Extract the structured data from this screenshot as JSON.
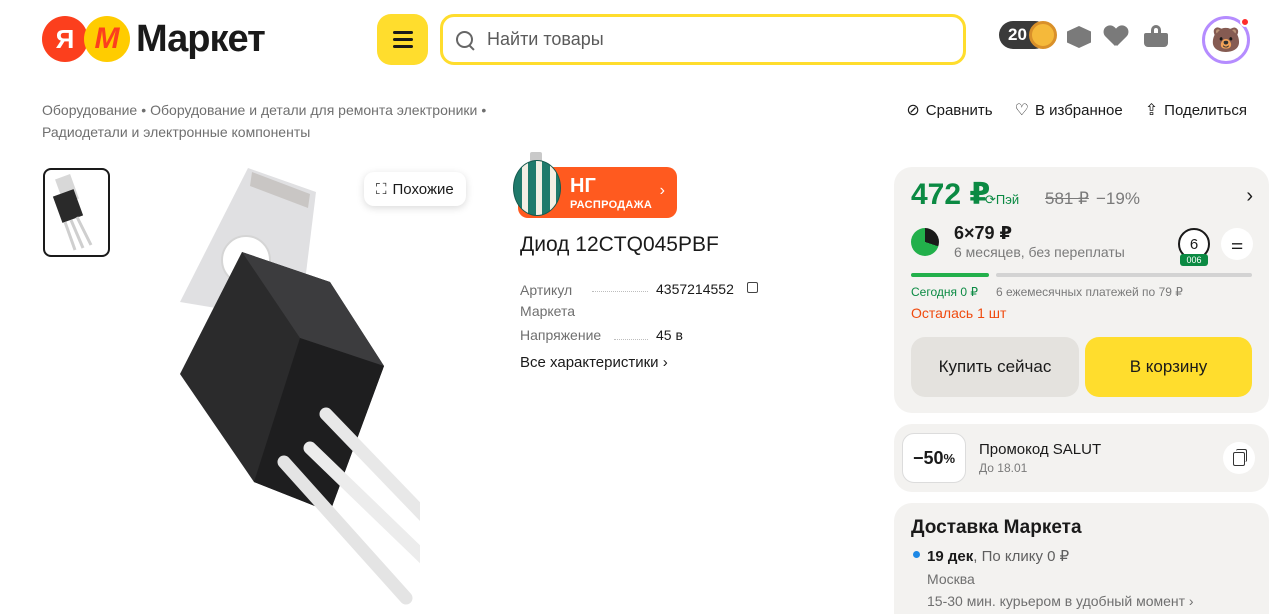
{
  "header": {
    "logo_ya": "Я",
    "logo_m": "M",
    "logo_text": "Маркет",
    "search_placeholder": "Найти товары",
    "coins": "20",
    "avatar_emoji": "🐻"
  },
  "breadcrumb": {
    "items": [
      "Оборудование",
      "Оборудование и детали для ремонта электроники",
      "Радиодетали и электронные компоненты"
    ]
  },
  "actions": {
    "compare": "Сравнить",
    "favorite": "В избранное",
    "share": "Поделиться"
  },
  "gallery": {
    "similar_label": "Похожие"
  },
  "product": {
    "badge_title": "НГ",
    "badge_sub": "РАСПРОДАЖА",
    "title": "Диод 12CTQ045PBF",
    "specs": [
      {
        "label": "Артикул Маркета",
        "value": "4357214552"
      },
      {
        "label": "Напряжение",
        "value": "45 в"
      }
    ],
    "all_specs": "Все характеристики"
  },
  "price_card": {
    "price": "472 ₽",
    "pay_label": "Пэй",
    "old_price": "581 ₽",
    "discount": "−19%",
    "split_main": "6×79 ₽",
    "split_sub": "6 месяцев, без переплаты",
    "split_count": "6",
    "split_tag": "006",
    "today": "Сегодня 0 ₽",
    "monthly": "6 ежемесячных платежей по 79 ₽",
    "stock": "Осталась 1 шт",
    "buy_now": "Купить сейчас",
    "to_cart": "В корзину"
  },
  "promo": {
    "badge": "−50",
    "badge_unit": "%",
    "title": "Промокод SALUT",
    "sub": "До 18.01"
  },
  "delivery": {
    "title": "Доставка Маркета",
    "date": "19 дек",
    "method": ", По клику",
    "price": "0 ₽",
    "city": "Москва",
    "time": "15-30 мин. курьером в удобный момент ›"
  },
  "colors": {
    "brand_yellow": "#ffdd2d",
    "price_green": "#0b8a43",
    "sale_orange": "#ff5a1f",
    "stock_red": "#f04a0e"
  }
}
